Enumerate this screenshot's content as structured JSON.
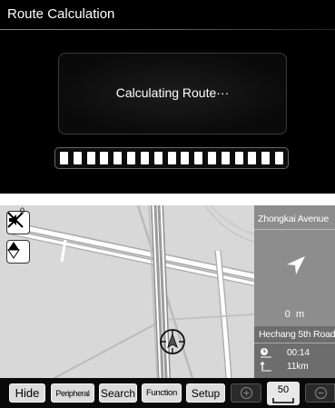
{
  "calculation": {
    "title": "Route Calculation",
    "message": "Calculating Route···",
    "progress_segments": 17
  },
  "map": {
    "mute_badge": "0",
    "icons": {
      "mute": "mute-speaker-icon",
      "compass": "compass-icon",
      "vehicle": "vehicle-position-icon"
    }
  },
  "guidance": {
    "current_street": "Zhongkai Avenue",
    "turn_icon": "turn-arrow-icon",
    "distance": "0  m",
    "next_street": "Hechang 5th Road",
    "time_remaining": "00:14",
    "distance_remaining": "11km"
  },
  "toolbar": {
    "hide": "Hide",
    "peripheral": "Peripheral",
    "search": "Search",
    "function": "Function",
    "setup": "Setup",
    "scale": "50",
    "icons": {
      "zoom_in": "zoom-in-icon",
      "zoom_out": "zoom-out-icon"
    }
  },
  "colors": {
    "calc_background": "#000000",
    "map_background": "#d8d8d8",
    "road_color": "#ffffff",
    "route_color": "#9a9a9a",
    "info_panel": "#8d8d8d",
    "toolbar_background": "#0a0a0a"
  }
}
